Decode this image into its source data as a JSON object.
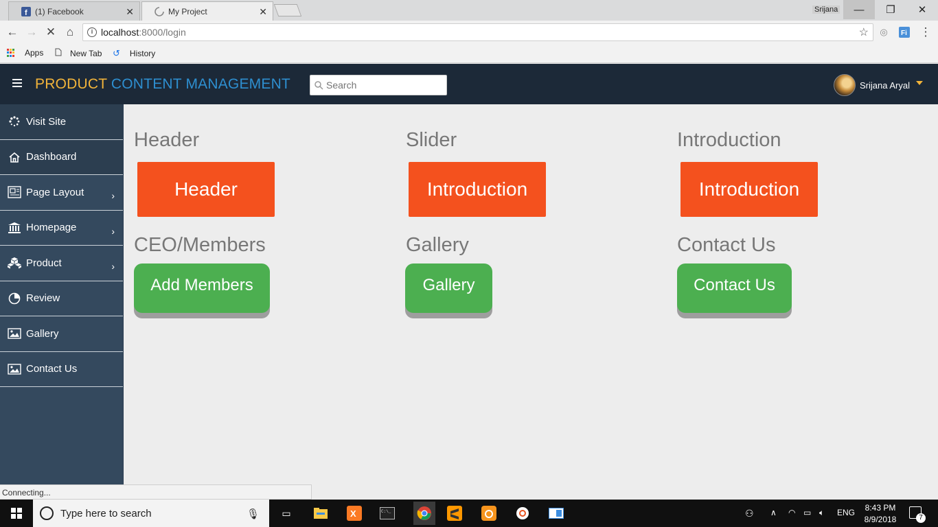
{
  "browser": {
    "tabs": [
      {
        "label": "(1) Facebook"
      },
      {
        "label": "My Project"
      }
    ],
    "profile_name": "Srijana",
    "url_host": "localhost",
    "url_path": ":8000/login",
    "bookmarks": [
      {
        "label": "Apps"
      },
      {
        "label": "New Tab"
      },
      {
        "label": "History"
      }
    ],
    "status_text": "Connecting..."
  },
  "header": {
    "brand_part1": "PRODUCT",
    "brand_part2": "CONTENT MANAGEMENT",
    "search_placeholder": "Search",
    "user_name": "Srijana Aryal"
  },
  "sidebar": {
    "items": [
      {
        "label": "Visit Site",
        "icon": "spinner-icon"
      },
      {
        "label": "Dashboard",
        "icon": "home-icon"
      },
      {
        "label": "Page Layout",
        "icon": "layout-icon"
      },
      {
        "label": "Homepage",
        "icon": "bank-icon"
      },
      {
        "label": "Product",
        "icon": "cubes-icon"
      },
      {
        "label": "Review",
        "icon": "pie-chart-icon"
      },
      {
        "label": "Gallery",
        "icon": "image-icon"
      },
      {
        "label": "Contact Us",
        "icon": "image-icon"
      }
    ]
  },
  "sections": [
    {
      "title": "Header",
      "button": "Header"
    },
    {
      "title": "Slider",
      "button": "Introduction"
    },
    {
      "title": "Introduction",
      "button": "Introduction"
    },
    {
      "title": "CEO/Members",
      "button": "Add Members"
    },
    {
      "title": "Gallery",
      "button": "Gallery"
    },
    {
      "title": "Contact Us",
      "button": "Contact Us"
    }
  ],
  "taskbar": {
    "search_text": "Type here to search",
    "language": "ENG",
    "time": "8:43 PM",
    "date": "8/9/2018",
    "notification_count": "7"
  },
  "colors": {
    "brand_yellow": "#f2b43a",
    "brand_blue": "#2e8fd0",
    "navbar": "#1c2938",
    "sidebar": "#34495e",
    "orange_button": "#f4511e",
    "green_button": "#4caf50"
  }
}
